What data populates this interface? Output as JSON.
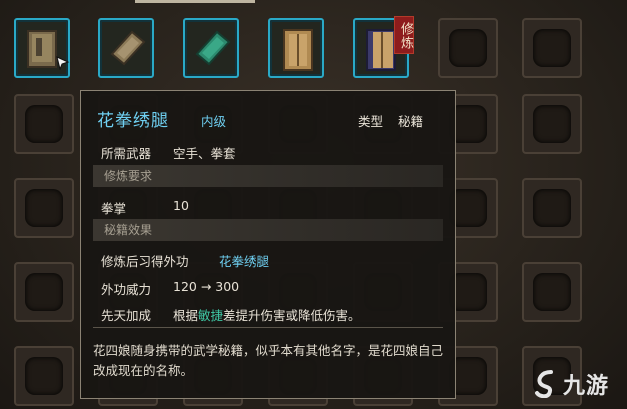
{
  "inventory": {
    "tag_text": "修炼"
  },
  "tooltip": {
    "title": "花拳绣腿",
    "grade": "内级",
    "type_label": "类型",
    "type_value": "秘籍",
    "weapon_label": "所需武器",
    "weapon_value": "空手、拳套",
    "section_requirements": "修炼要求",
    "req_label": "拳掌",
    "req_value": "10",
    "section_effects": "秘籍效果",
    "learn_label": "修炼后习得外功",
    "learn_value": "花拳绣腿",
    "power_label": "外功威力",
    "power_value": "120 → 300",
    "innate_label": "先天加成",
    "innate_prefix": "根据",
    "innate_highlight": "敏捷",
    "innate_suffix": "差提升伤害或降低伤害。",
    "description": "花四娘随身携带的武学秘籍，似乎本有其他名字，是花四娘自己改成现在的名称。"
  },
  "watermark": {
    "text": "九游"
  },
  "colors": {
    "accent": "#6fd0f2",
    "highlight": "#3fc9a6",
    "slot_border": "#2aa9c7",
    "tag_bg": "#8d1c1c"
  }
}
